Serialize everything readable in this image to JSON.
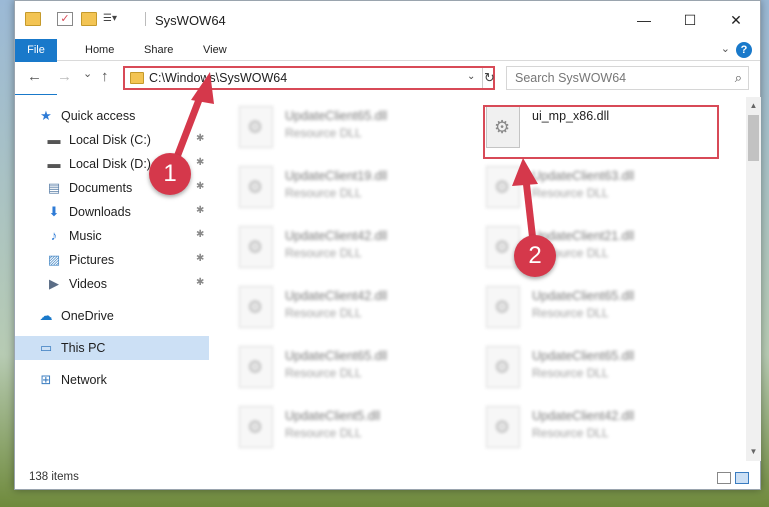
{
  "window": {
    "title": "SysWOW64",
    "minimize": "—",
    "maximize": "☐",
    "close": "✕"
  },
  "ribbon": {
    "tabs": [
      "File",
      "Home",
      "Share",
      "View"
    ],
    "help": "?"
  },
  "nav": {
    "back": "←",
    "forward": "→",
    "recent": "⌄",
    "up": "↑",
    "address": "C:\\Windows\\SysWOW64",
    "address_dropdown": "⌄",
    "refresh": "↻",
    "search_placeholder": "Search SysWOW64"
  },
  "sidebar": {
    "items": [
      {
        "label": "Quick access",
        "icon": "star-icon",
        "glyph": "★",
        "color": "#2e7bd6"
      },
      {
        "label": "Local Disk (C:)",
        "icon": "drive-icon",
        "glyph": "▬",
        "color": "#555555",
        "pinned": true
      },
      {
        "label": "Local Disk (D:)",
        "icon": "drive-icon",
        "glyph": "▬",
        "color": "#555555",
        "pinned": true
      },
      {
        "label": "Documents",
        "icon": "documents-icon",
        "glyph": "▤",
        "color": "#5b7fa8",
        "pinned": true
      },
      {
        "label": "Downloads",
        "icon": "download-icon",
        "glyph": "⬇",
        "color": "#2e7bd6",
        "pinned": true
      },
      {
        "label": "Music",
        "icon": "music-icon",
        "glyph": "♪",
        "color": "#2e7bd6",
        "pinned": true
      },
      {
        "label": "Pictures",
        "icon": "pictures-icon",
        "glyph": "▨",
        "color": "#4a8bc7",
        "pinned": true
      },
      {
        "label": "Videos",
        "icon": "videos-icon",
        "glyph": "▶",
        "color": "#5b6d86",
        "pinned": true
      },
      {
        "label": "OneDrive",
        "icon": "onedrive-icon",
        "glyph": "☁",
        "color": "#1979ca"
      },
      {
        "label": "This PC",
        "icon": "computer-icon",
        "glyph": "▭",
        "color": "#3a7cc0",
        "selected": true
      },
      {
        "label": "Network",
        "icon": "network-icon",
        "glyph": "⊞",
        "color": "#3a7cc0"
      }
    ]
  },
  "files": {
    "column1": [
      {
        "name": "UpdateClient65.dll",
        "type": "Resource DLL"
      },
      {
        "name": "UpdateClient19.dll",
        "type": "Resource DLL"
      },
      {
        "name": "UpdateClient42.dll",
        "type": "Resource DLL"
      },
      {
        "name": "UpdateClient42.dll",
        "type": "Resource DLL"
      },
      {
        "name": "UpdateClient65.dll",
        "type": "Resource DLL"
      },
      {
        "name": "UpdateClient5.dll",
        "type": "Resource DLL"
      }
    ],
    "column2": [
      {
        "name": "ui_mp_x86.dll",
        "type": "",
        "highlighted": true
      },
      {
        "name": "UpdateClient63.dll",
        "type": "Resource DLL"
      },
      {
        "name": "UpdateClient21.dll",
        "type": "Resource DLL"
      },
      {
        "name": "UpdateClient65.dll",
        "type": "Resource DLL"
      },
      {
        "name": "UpdateClient65.dll",
        "type": "Resource DLL"
      },
      {
        "name": "UpdateClient42.dll",
        "type": "Resource DLL"
      }
    ]
  },
  "status": {
    "item_count": "138 items"
  },
  "annotations": {
    "step1": "1",
    "step2": "2",
    "color": "#d5384b"
  }
}
